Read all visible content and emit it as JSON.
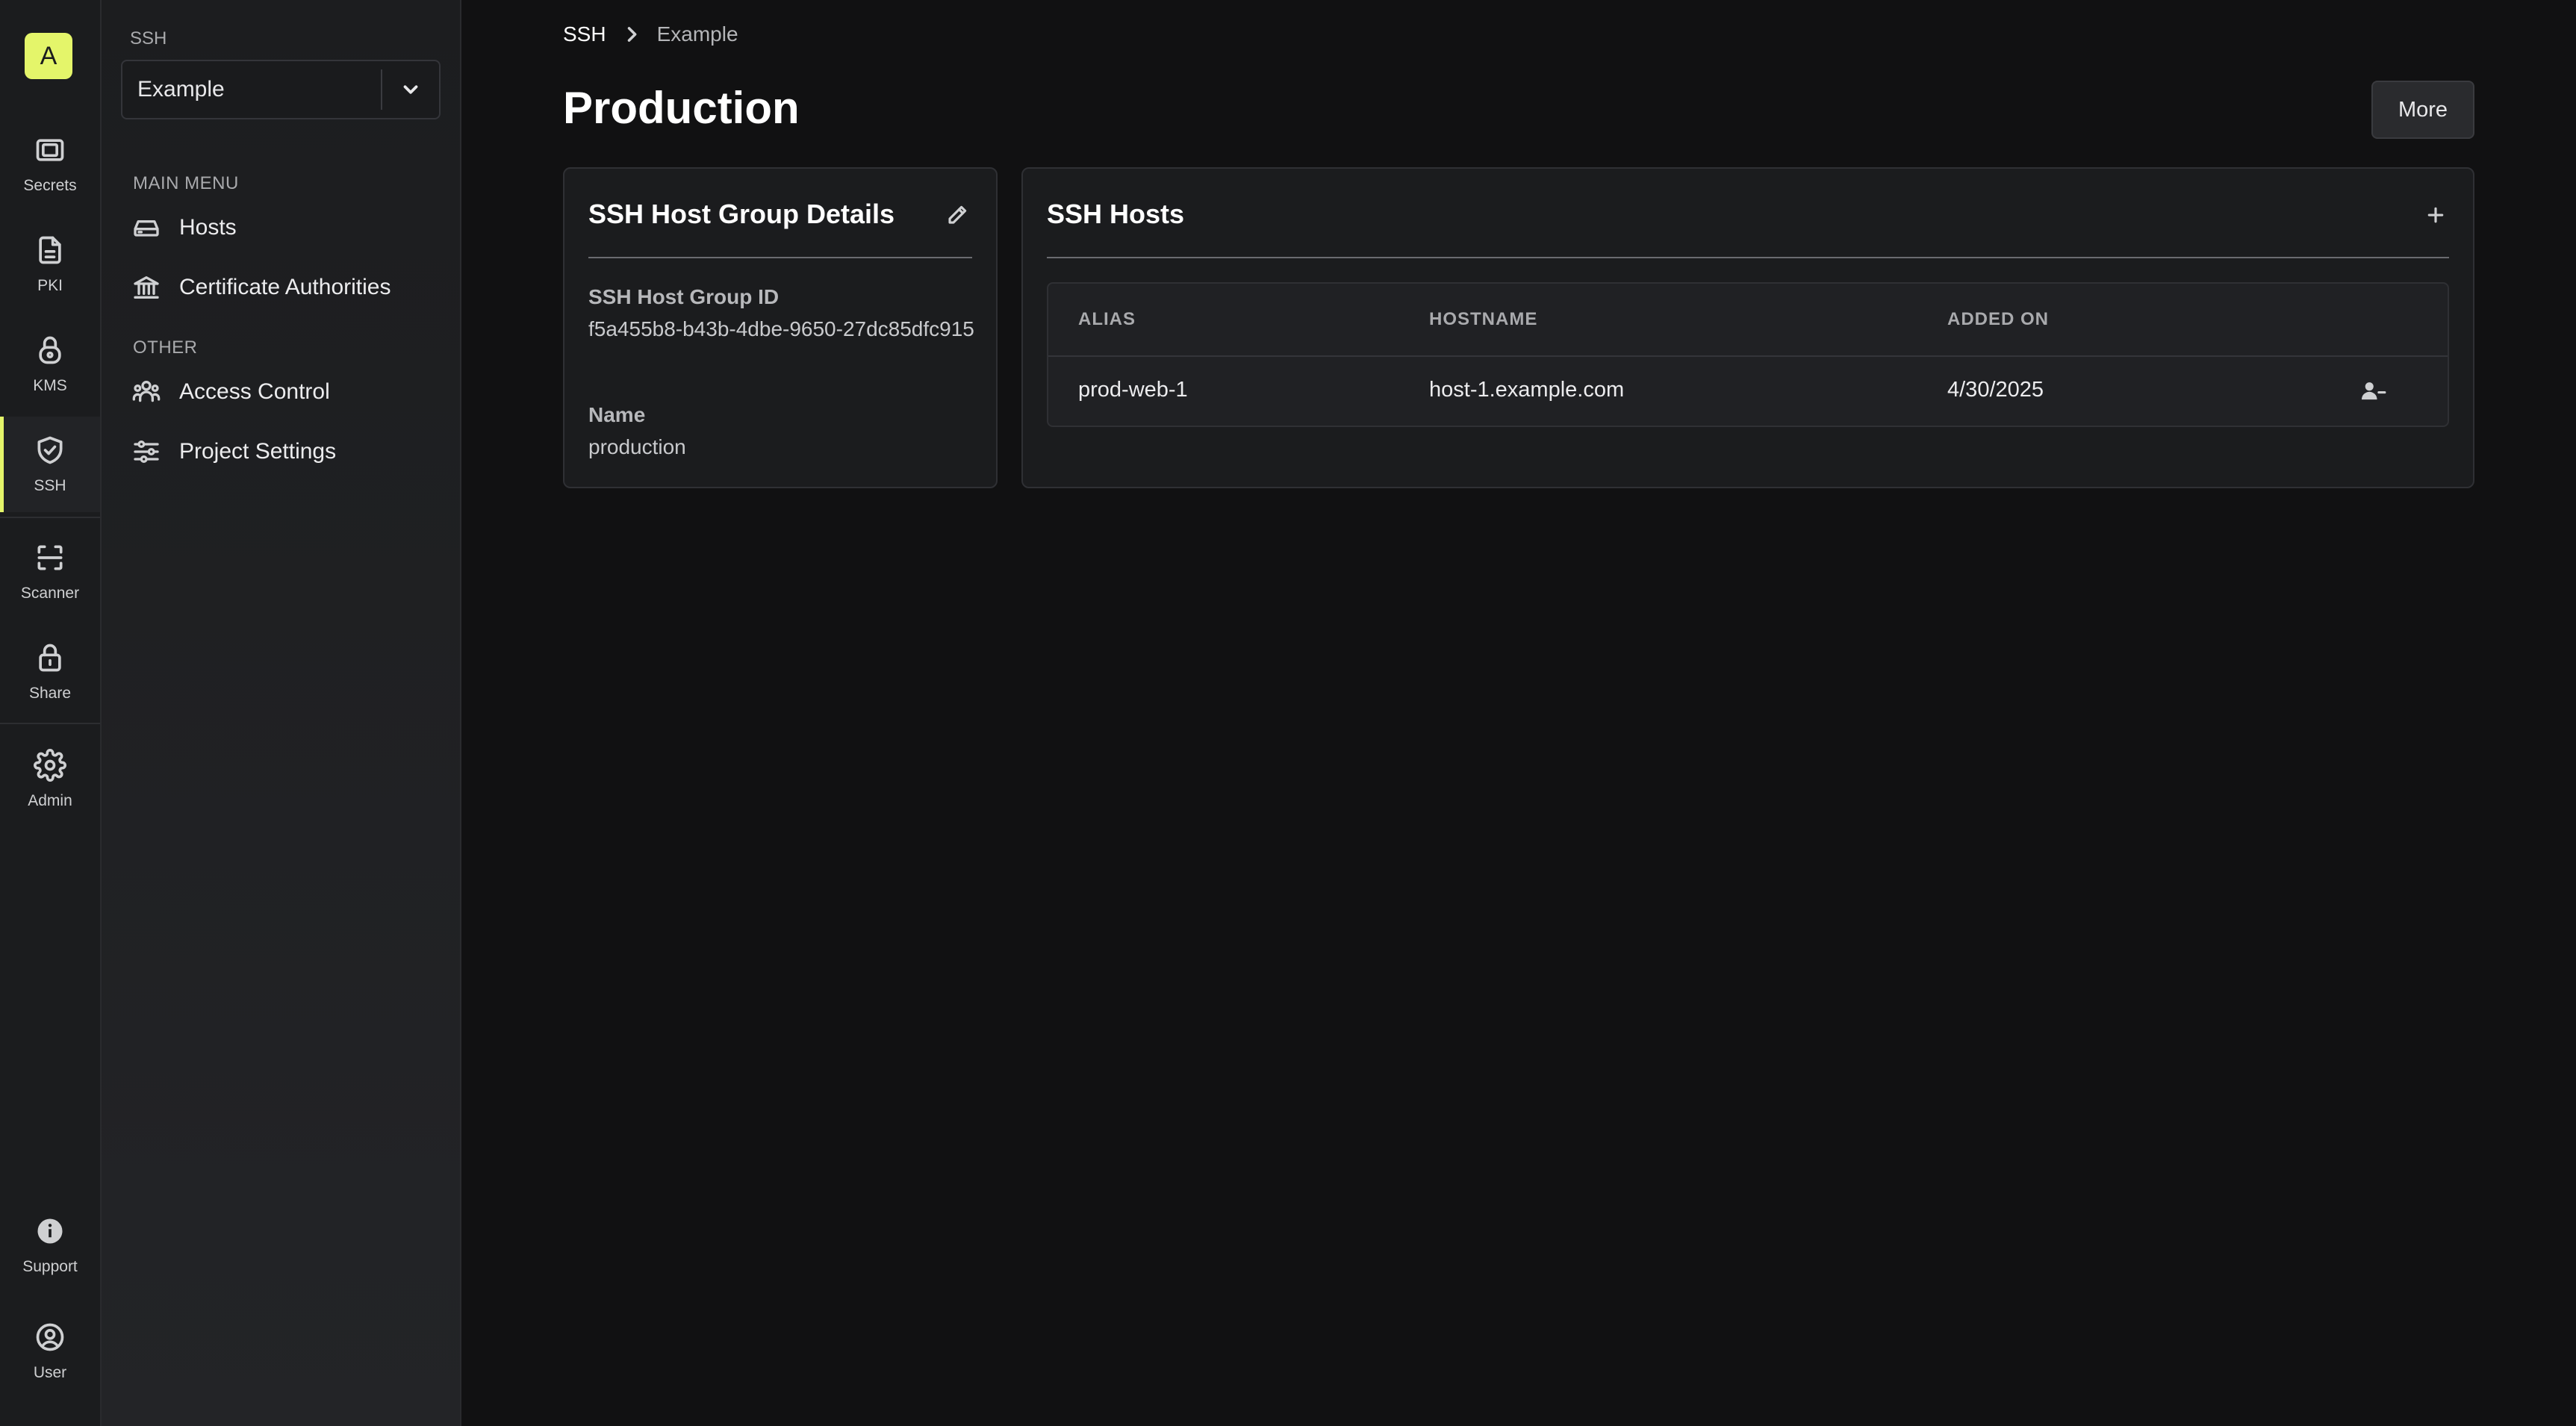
{
  "rail": {
    "org_initial": "A",
    "items": [
      {
        "label": "Secrets",
        "icon": "vault-icon"
      },
      {
        "label": "PKI",
        "icon": "document-icon"
      },
      {
        "label": "KMS",
        "icon": "lock-icon"
      },
      {
        "label": "SSH",
        "icon": "shield-check-icon"
      },
      {
        "label": "Scanner",
        "icon": "scan-icon"
      },
      {
        "label": "Share",
        "icon": "padlock-icon"
      },
      {
        "label": "Admin",
        "icon": "gear-icon"
      }
    ],
    "support_label": "Support",
    "user_label": "User",
    "accent": "#e4f56a"
  },
  "sidebar": {
    "kicker": "SSH",
    "project_select_value": "Example",
    "main_menu_label": "MAIN MENU",
    "main_items": [
      {
        "label": "Hosts",
        "icon": "server-icon"
      },
      {
        "label": "Certificate Authorities",
        "icon": "bank-icon"
      }
    ],
    "other_label": "OTHER",
    "other_items": [
      {
        "label": "Access Control",
        "icon": "users-icon"
      },
      {
        "label": "Project Settings",
        "icon": "sliders-icon"
      }
    ]
  },
  "breadcrumb": {
    "root": "SSH",
    "current": "Example"
  },
  "page": {
    "title": "Production",
    "more_label": "More"
  },
  "details_card": {
    "title": "SSH Host Group Details",
    "id_label": "SSH Host Group ID",
    "id_value": "f5a455b8-b43b-4dbe-9650-27dc85dfc915",
    "name_label": "Name",
    "name_value": "production"
  },
  "hosts_card": {
    "title": "SSH Hosts",
    "columns": [
      "ALIAS",
      "HOSTNAME",
      "ADDED ON"
    ],
    "rows": [
      {
        "alias": "prod-web-1",
        "hostname": "host-1.example.com",
        "added_on": "4/30/2025"
      }
    ]
  }
}
